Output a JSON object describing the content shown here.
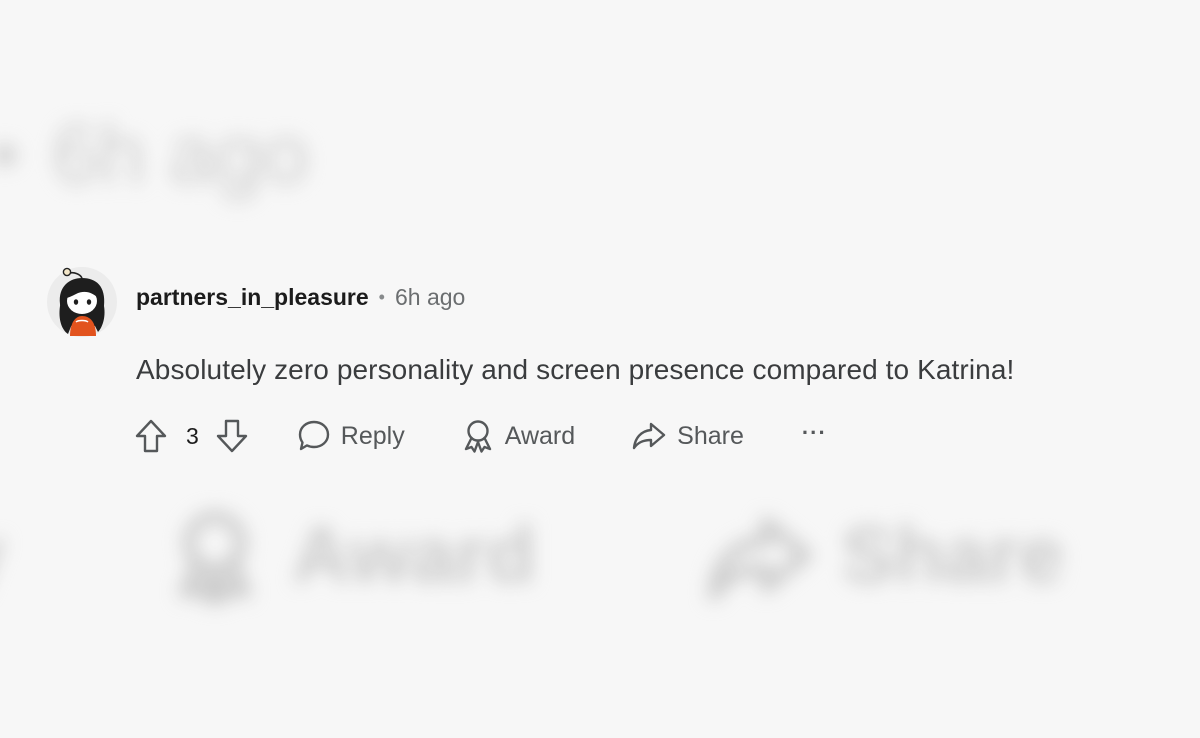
{
  "background": {
    "top_time": "6h ago",
    "bottom_award": "Award",
    "bottom_share": "Share",
    "bottom_reply_fragment": "y"
  },
  "comment": {
    "username": "partners_in_pleasure",
    "separator": "•",
    "time": "6h ago",
    "text": "Absolutely zero personality and screen presence compared to Katrina!",
    "votes": "3",
    "actions": {
      "reply": "Reply",
      "award": "Award",
      "share": "Share",
      "more": "···"
    }
  },
  "icons": {
    "upvote": "upvote-arrow-icon",
    "downvote": "downvote-arrow-icon",
    "reply": "speech-bubble-icon",
    "award": "award-ribbon-icon",
    "share": "share-arrow-icon",
    "more": "ellipsis-icon"
  },
  "colors": {
    "background": "#f7f7f7",
    "text_primary": "#1c1c1c",
    "text_secondary": "#55585a",
    "avatar_accent": "#e2531e"
  }
}
